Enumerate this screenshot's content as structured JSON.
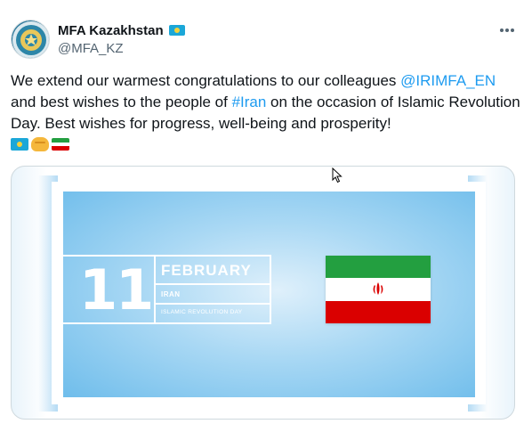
{
  "account": {
    "display_name": "MFA Kazakhstan",
    "handle": "@MFA_KZ",
    "verified_badge": "kazakhstan-flag"
  },
  "tweet": {
    "text_part1": "We extend our warmest congratulations to our colleagues ",
    "mention": "@IRIMFA_EN",
    "text_part2": " and best wishes to the people of ",
    "hashtag": "#Iran",
    "text_part3": " on the occasion of Islamic Revolution Day. Best wishes for progress, well-being and prosperity!",
    "emojis": [
      "kazakhstan-flag",
      "handshake",
      "iran-flag"
    ]
  },
  "media": {
    "day": "11",
    "month": "FEBRUARY",
    "country": "IRAN",
    "occasion": "ISLAMIC REVOLUTION DAY",
    "flag": "iran-flag"
  },
  "colors": {
    "link": "#1d9bf0",
    "text": "#0f1419",
    "secondary": "#536471",
    "poster_blue": "#6fbdeb",
    "flag_green": "#239f40",
    "flag_red": "#da0000"
  }
}
